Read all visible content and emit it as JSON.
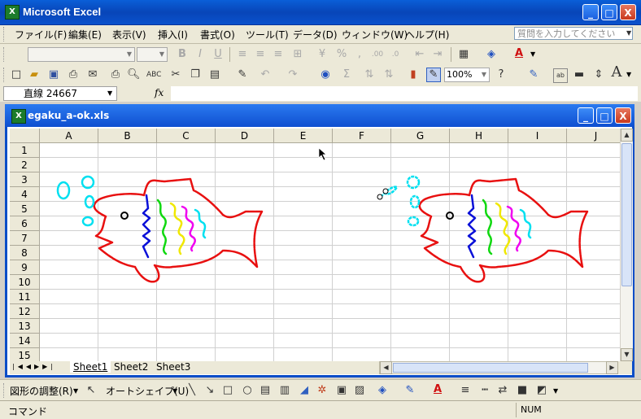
{
  "app": {
    "title": "Microsoft Excel"
  },
  "window_buttons": {
    "minimize": "_",
    "maximize": "□",
    "close": "X"
  },
  "menu": [
    "ファイル(F)",
    "編集(E)",
    "表示(V)",
    "挿入(I)",
    "書式(O)",
    "ツール(T)",
    "データ(D)",
    "ウィンドウ(W)",
    "ヘルプ(H)"
  ],
  "help_box": {
    "placeholder": "質問を入力してください"
  },
  "toolbar": {
    "zoom": "100%",
    "font_size_letter": "A"
  },
  "formula_bar": {
    "name_box": "直線 24667",
    "fx": "fx",
    "content": ""
  },
  "workbook": {
    "title": "egaku_a-ok.xls"
  },
  "columns": [
    "A",
    "B",
    "C",
    "D",
    "E",
    "F",
    "G",
    "H",
    "I",
    "J"
  ],
  "rows": [
    "1",
    "2",
    "3",
    "4",
    "5",
    "6",
    "7",
    "8",
    "9",
    "10",
    "11",
    "12",
    "13",
    "14",
    "15"
  ],
  "sheets": [
    {
      "name": "Sheet1",
      "active": true
    },
    {
      "name": "Sheet2",
      "active": false
    },
    {
      "name": "Sheet3",
      "active": false
    }
  ],
  "drawing_toolbar": {
    "draw_menu": "図形の調整(R)",
    "autoshapes_menu": "オートシェイプ(U)"
  },
  "status_bar": {
    "mode": "コマンド",
    "num": "NUM"
  },
  "colors": {
    "fish_outline": "#e81010",
    "fins": "#0a10d8",
    "bubbles": "#00e0f0",
    "stripe_green": "#10d810",
    "stripe_yellow": "#f0f000",
    "stripe_magenta": "#f000f0",
    "title_blue": "#0a52cc"
  }
}
